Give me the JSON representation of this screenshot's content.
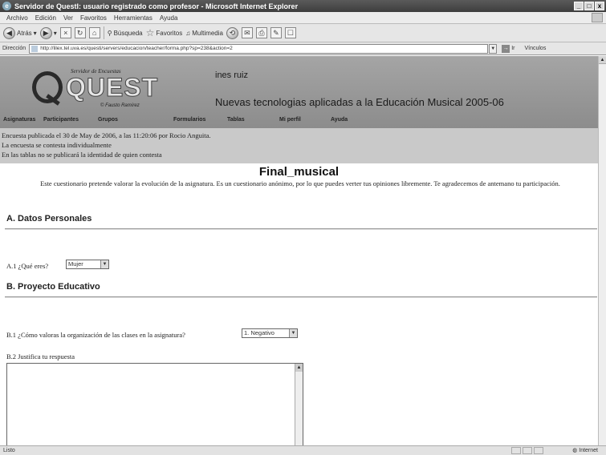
{
  "window": {
    "title": "Servidor de QuestI: usuario registrado como profesor - Microsoft Internet Explorer",
    "controls": [
      "_",
      "□",
      "x"
    ]
  },
  "menu": [
    "Archivo",
    "Edición",
    "Ver",
    "Favoritos",
    "Herramientas",
    "Ayuda"
  ],
  "toolbar": {
    "back": "Atrás",
    "search": "Búsqueda",
    "favorites": "Favoritos",
    "multimedia": "Multimedia"
  },
  "address": {
    "label": "Dirección",
    "url": "http://lilex.tel.uva.es/questi/servers/educacion/teacher/forma.php?sp=238&action=2",
    "go": "Ir",
    "links": "Vínculos"
  },
  "site": {
    "logo_top": "Servidor de Encuestas",
    "logo_name": "QUEST",
    "logo_by": "© Fausto Ramírez",
    "user": "ines ruiz",
    "course": "Nuevas tecnologias aplicadas a la Educación Musical 2005-06",
    "nav": [
      "Asignaturas",
      "Participantes",
      "Grupos",
      "Formularios",
      "Tablas",
      "Mi perfil",
      "Ayuda"
    ]
  },
  "info": [
    "Encuesta publicada el 30 de May de 2006, a las 11:20:06 por Rocio Anguita.",
    "La encuesta se contesta individualmente",
    "En las tablas no se publicará la identidad de quien contesta"
  ],
  "survey": {
    "title": "Final_musical",
    "description": "Este cuestionario pretende valorar la evolución de la asignatura. Es un cuestionario anónimo, por lo que puedes verter tus opiniones libremente. Te agradecemos de antemano tu participación.",
    "sections": [
      {
        "heading": "A. Datos Personales"
      },
      {
        "heading": "B. Proyecto Educativo"
      }
    ],
    "questions": {
      "a1": {
        "label": "A.1 ¿Qué eres?",
        "value": "Mujer"
      },
      "b1": {
        "label": "B.1 ¿Cómo valoras la organización de las clases en la asignatura?",
        "value": "1. Negativo"
      },
      "b2": {
        "label": "B.2 Justifica tu respuesta",
        "value": ""
      }
    }
  },
  "status": {
    "text": "Listo",
    "zone": "Internet"
  }
}
